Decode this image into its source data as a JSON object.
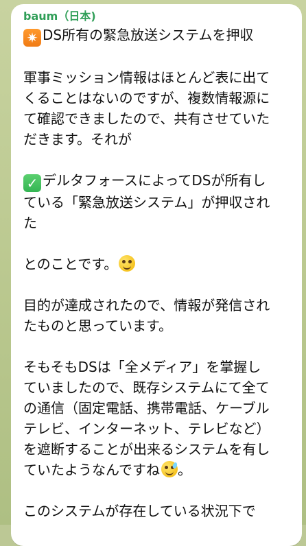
{
  "message": {
    "sender": "baum（日本)",
    "line_1": "DS所有の緊急放送システムを押収",
    "line_2": "軍事ミッション情報はほとんど表に出て",
    "line_3": "くることはないのですが、複数情報源に",
    "line_4": "て確認できましたので、共有させていた",
    "line_5": "だきます。それが",
    "line_6": "デルタフォースによってDSが所有し",
    "line_7": "ている「緊急放送システム」が押収され",
    "line_8": "た",
    "line_9": "とのことです。",
    "line_10": "目的が達成されたので、情報が発信され",
    "line_11": "たものと思っています。",
    "line_12": "そもそもDSは「全メディア」を掌握し",
    "line_13": "ていましたので、既存システムにて全て",
    "line_14": "の通信（固定電話、携帯電話、ケーブル",
    "line_15": "テレビ、インターネット、テレビなど）",
    "line_16": "を遮断することが出来るシステムを有し",
    "line_17": "ていたようなんですね",
    "line_17_suffix": "。",
    "line_18": "このシステムが存在している状況下で"
  },
  "icons": {
    "first_line_icon": "sparkle-icon",
    "check_icon": "check-icon",
    "laugh_icon": "laughing-face-icon",
    "sweat_icon": "grinning-sweat-face-icon"
  },
  "colors": {
    "sender": "#2f9e57",
    "bubble": "#ffffff",
    "background": "#bcc895",
    "sparkle": "#f07b15",
    "check": "#34b553"
  }
}
